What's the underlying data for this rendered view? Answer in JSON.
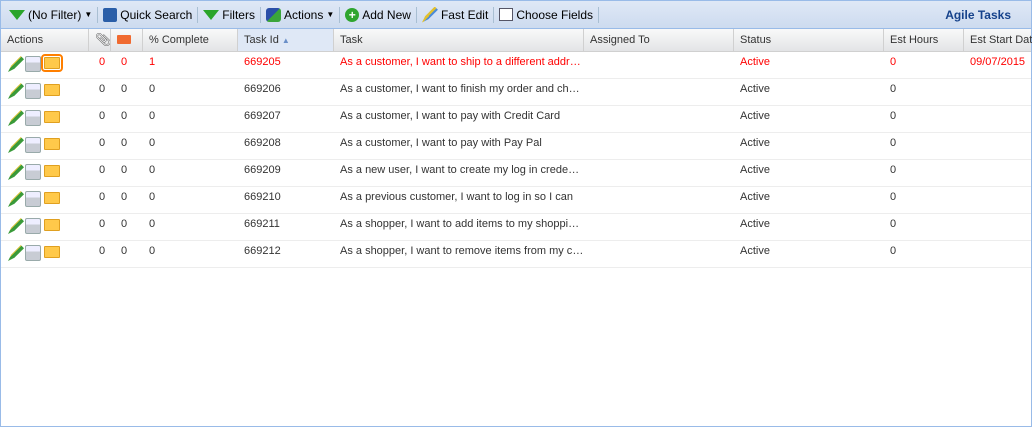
{
  "toolbar": {
    "filter": "(No Filter)",
    "quick_search": "Quick Search",
    "filters": "Filters",
    "actions": "Actions",
    "add_new": "Add New",
    "fast_edit": "Fast Edit",
    "choose_fields": "Choose Fields",
    "title": "Agile Tasks"
  },
  "columns": {
    "actions": "Actions",
    "complete": "% Complete",
    "task_id": "Task Id",
    "task": "Task",
    "assigned": "Assigned To",
    "status": "Status",
    "est_hours": "Est Hours",
    "est_start": "Est Start Date"
  },
  "rows": [
    {
      "att": "0",
      "com": "0",
      "pct": "1",
      "id": "669205",
      "task": "As a customer, I want to ship to a different address",
      "assigned": "",
      "status": "Active",
      "hours": "0",
      "start": "09/07/2015"
    },
    {
      "att": "0",
      "com": "0",
      "pct": "0",
      "id": "669206",
      "task": "As a customer, I want to finish my order and check out",
      "assigned": "",
      "status": "Active",
      "hours": "0",
      "start": ""
    },
    {
      "att": "0",
      "com": "0",
      "pct": "0",
      "id": "669207",
      "task": "As a customer, I want to pay with Credit Card",
      "assigned": "",
      "status": "Active",
      "hours": "0",
      "start": ""
    },
    {
      "att": "0",
      "com": "0",
      "pct": "0",
      "id": "669208",
      "task": "As a customer, I want to pay with Pay Pal",
      "assigned": "",
      "status": "Active",
      "hours": "0",
      "start": ""
    },
    {
      "att": "0",
      "com": "0",
      "pct": "0",
      "id": "669209",
      "task": "As a new user, I want to create my log in credentials",
      "assigned": "",
      "status": "Active",
      "hours": "0",
      "start": ""
    },
    {
      "att": "0",
      "com": "0",
      "pct": "0",
      "id": "669210",
      "task": "As a previous customer, I want to log in so I can",
      "assigned": "",
      "status": "Active",
      "hours": "0",
      "start": ""
    },
    {
      "att": "0",
      "com": "0",
      "pct": "0",
      "id": "669211",
      "task": "As a shopper, I want to add items to my shopping cart",
      "assigned": "",
      "status": "Active",
      "hours": "0",
      "start": ""
    },
    {
      "att": "0",
      "com": "0",
      "pct": "0",
      "id": "669212",
      "task": "As a shopper, I want to remove items from my cart",
      "assigned": "",
      "status": "Active",
      "hours": "0",
      "start": ""
    }
  ]
}
